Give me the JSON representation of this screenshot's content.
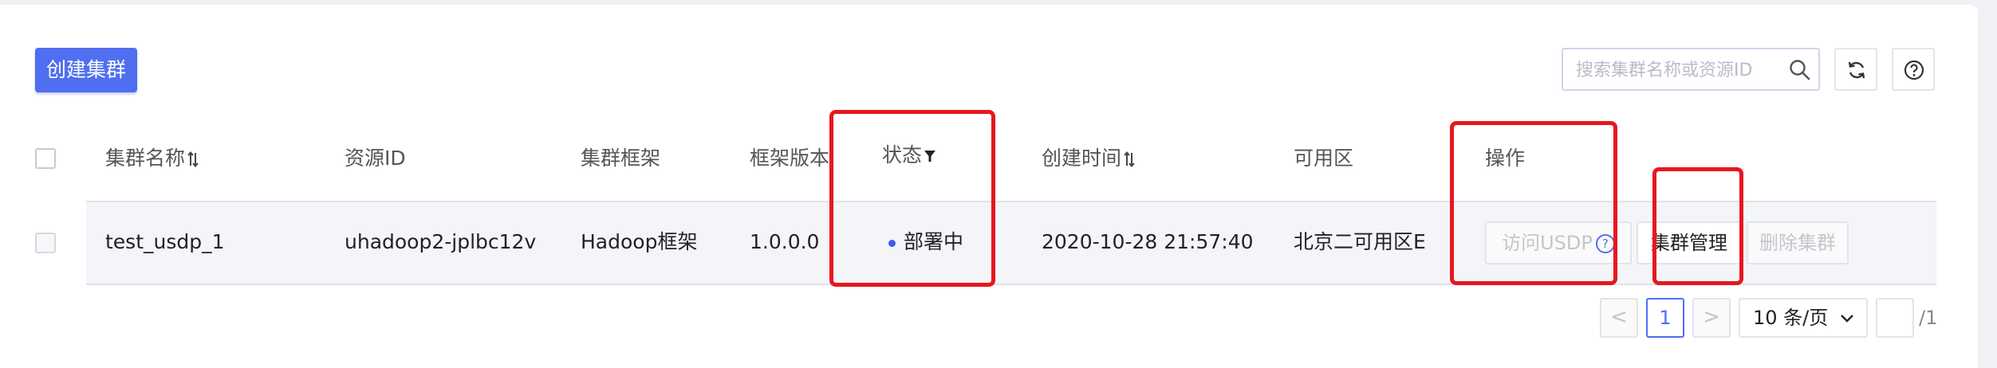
{
  "toolbar": {
    "create_label": "创建集群",
    "search_placeholder": "搜索集群名称或资源ID",
    "search_value": ""
  },
  "icons": {
    "search": "search-icon",
    "refresh": "refresh-icon",
    "help": "help-icon",
    "sort": "sort-icon",
    "filter": "filter-icon"
  },
  "table": {
    "columns": {
      "name": "集群名称",
      "resource_id": "资源ID",
      "framework": "集群框架",
      "framework_version": "框架版本",
      "status": "状态",
      "created_at": "创建时间",
      "zone": "可用区",
      "actions": "操作"
    },
    "rows": [
      {
        "name": "test_usdp_1",
        "resource_id": "uhadoop2-jplbc12v",
        "framework": "Hadoop框架",
        "framework_version": "1.0.0.0",
        "status": "部署中",
        "created_at": "2020-10-28 21:57:40",
        "zone": "北京二可用区E",
        "actions": {
          "visit": "访问USDP",
          "visit_help": "?",
          "manage": "集群管理",
          "delete": "删除集群"
        }
      }
    ]
  },
  "pagination": {
    "prev": "<",
    "current_page": "1",
    "next": ">",
    "page_size": "10 条/页",
    "total": "/1"
  },
  "colors": {
    "accent": "#4f6ff0",
    "annotation": "#e8161f",
    "status_deploying": "#3d5bf0"
  }
}
